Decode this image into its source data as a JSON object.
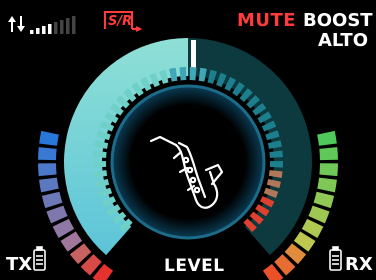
{
  "status": {
    "mute_label": "MUTE",
    "boost_label": "BOOST",
    "instrument_label": "ALTO",
    "sr_label": "S/R",
    "tx_label": "TX",
    "rx_label": "RX",
    "level_label": "LEVEL",
    "signal_bars_active": 4,
    "signal_bars_total": 8
  },
  "meters": {
    "tx_segments_lit": 11,
    "rx_segments_lit": 11,
    "segments_total": 11,
    "level_fraction": 0.5
  },
  "icons": {
    "center": "saxophone-icon",
    "signal": "signal-arrows-icon",
    "tx_battery": "battery-icon",
    "rx_battery": "battery-icon"
  },
  "colors": {
    "accent_red": "#ff3b3b",
    "level_arc_light": "#7fd4d4",
    "level_arc_dark": "#0e3b40"
  }
}
